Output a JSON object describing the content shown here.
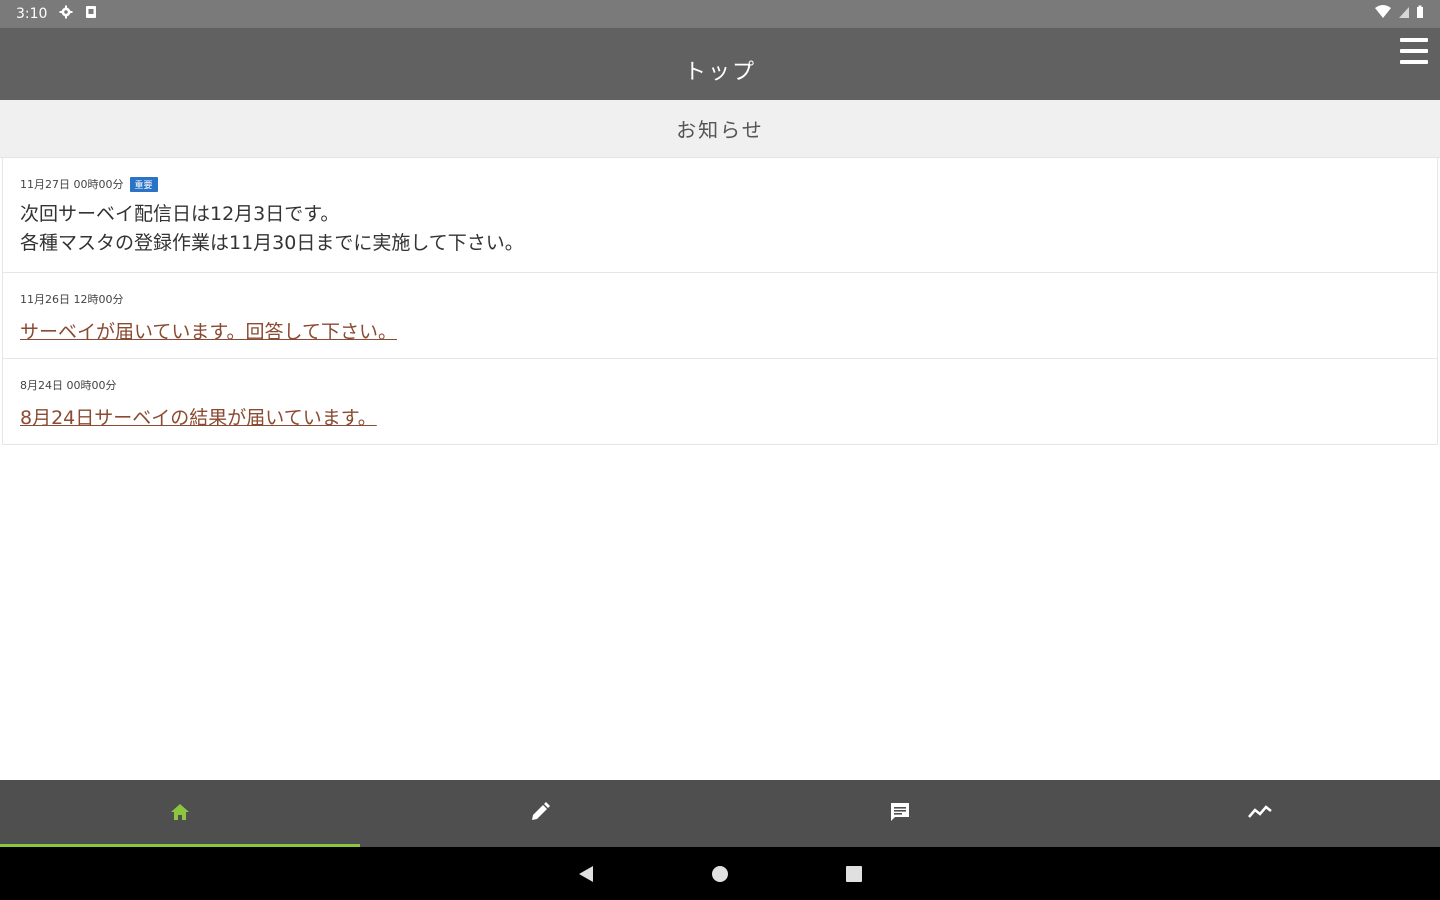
{
  "status_bar": {
    "time": "3:10",
    "icons": [
      "settings-gear-icon",
      "sd-card-icon",
      "wifi-icon",
      "cell-signal-icon",
      "battery-icon"
    ]
  },
  "app_bar": {
    "title": "トップ",
    "menu_icon": "hamburger-menu-icon"
  },
  "section": {
    "title": "お知らせ"
  },
  "news": [
    {
      "date": "11月27日 00時00分",
      "badge": "重要",
      "text": "次回サーベイ配信日は12月3日です。\n各種マスタの登録作業は11月30日までに実施して下さい。"
    },
    {
      "date": "11月26日 12時00分",
      "link": "サーベイが届いています。回答して下さい。"
    },
    {
      "date": "8月24日 00時00分",
      "link": "8月24日サーベイの結果が届いています。"
    }
  ],
  "bottom_nav": {
    "tabs": [
      "home-icon",
      "pencil-icon",
      "chat-icon",
      "trend-chart-icon"
    ],
    "active_index": 0
  },
  "colors": {
    "status_bar": "#7a7a7a",
    "app_bar": "#616161",
    "section_header": "#f0f0f0",
    "badge": "#2b73c4",
    "link": "#8b4a32",
    "bottom_nav": "#4f4f4f",
    "active_accent": "#8cc63f"
  }
}
